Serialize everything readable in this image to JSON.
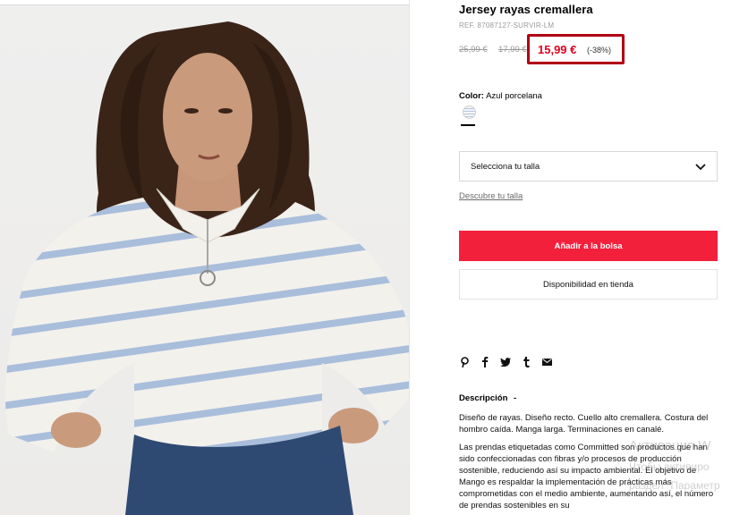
{
  "product": {
    "title": "Jersey rayas cremallera",
    "ref": "REF. 87087127-SURVIR-LM",
    "old_price_1": "25,99 €",
    "old_price_2": "17,99 €",
    "price": "15,99 €",
    "discount": "(-38%)"
  },
  "color": {
    "label": "Color:",
    "value": "Azul porcelana"
  },
  "size": {
    "select_label": "Selecciona tu talla",
    "guide_link": "Descubre tu talla"
  },
  "actions": {
    "add_to_bag": "Añadir a la bolsa",
    "store_availability": "Disponibilidad en tienda"
  },
  "share": {
    "icons": [
      "pinterest-icon",
      "facebook-icon",
      "twitter-icon",
      "tumblr-icon",
      "email-icon"
    ]
  },
  "description": {
    "title": "Descripción",
    "toggle": "-",
    "p1": "Diseño de rayas. Diseño recto. Cuello alto cremallera. Costura del hombro caída. Manga larga. Terminaciones en canalé.",
    "p2": "Las prendas etiquetadas como Committed son productos que han sido confeccionadas con fibras y/o procesos de producción sostenible, reduciendo así su impacto ambiental. El objetivo de Mango es respaldar la implementación de prácticas más comprometidas con el medio ambiente, aumentando así, el número de prendas sostenibles en su"
  },
  "watermark": {
    "line1": "Активация W",
    "line2": "Чтобы активиро",
    "line3": "раздел \"Параметр"
  },
  "colors": {
    "accent": "#f3203c",
    "price_red": "#e1001f",
    "highlight_border": "#b00012"
  }
}
